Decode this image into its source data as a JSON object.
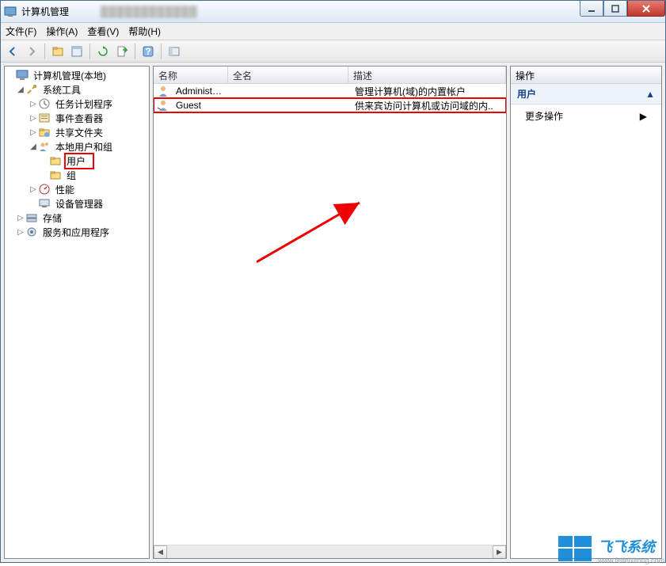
{
  "window": {
    "title": "计算机管理"
  },
  "menu": {
    "file": "文件(F)",
    "action": "操作(A)",
    "view": "查看(V)",
    "help": "帮助(H)"
  },
  "tree": {
    "root": "计算机管理(本地)",
    "system_tools": "系统工具",
    "task_scheduler": "任务计划程序",
    "event_viewer": "事件查看器",
    "shared_folders": "共享文件夹",
    "local_users": "本地用户和组",
    "users": "用户",
    "groups": "组",
    "performance": "性能",
    "device_manager": "设备管理器",
    "storage": "存储",
    "services_apps": "服务和应用程序"
  },
  "list": {
    "headers": {
      "name": "名称",
      "fullname": "全名",
      "description": "描述"
    },
    "rows": [
      {
        "name": "Administrat...",
        "fullname": "",
        "description": "管理计算机(域)的内置帐户"
      },
      {
        "name": "Guest",
        "fullname": "",
        "description": "供来宾访问计算机或访问域的内.."
      }
    ]
  },
  "actions": {
    "header": "操作",
    "section": "用户",
    "more": "更多操作"
  },
  "watermark": {
    "brand": "飞飞系统",
    "url": "www.feifeixitong.com"
  }
}
